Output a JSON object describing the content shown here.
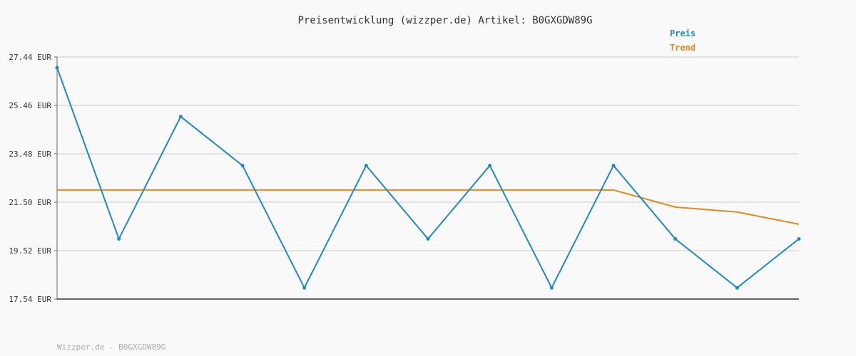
{
  "colors": {
    "price": "#1f88c8",
    "trend": "#e0891f",
    "grid": "#e2e2e2",
    "axis": "#666666",
    "background": "#f9f9f9"
  },
  "chart_data": {
    "type": "line",
    "title": "Preisentwicklung (wizzper.de) Artikel: B0GXGDW89G",
    "xlabel": "",
    "ylabel": "",
    "x": [
      0,
      1,
      2,
      3,
      4,
      5,
      6,
      7,
      8,
      9,
      10,
      11,
      12
    ],
    "ylim": [
      17.54,
      27.44
    ],
    "yticks": [
      17.54,
      19.52,
      21.5,
      23.48,
      25.46,
      27.44
    ],
    "ytick_labels": [
      "17.54 EUR",
      "19.52 EUR",
      "21.50 EUR",
      "23.48 EUR",
      "25.46 EUR",
      "27.44 EUR"
    ],
    "grid": true,
    "legend_position": "top-right",
    "series": [
      {
        "name": "Preis",
        "values": [
          27.0,
          20.0,
          25.0,
          23.0,
          18.0,
          23.0,
          20.0,
          23.0,
          18.0,
          23.0,
          20.0,
          18.0,
          20.0
        ],
        "markers": true
      },
      {
        "name": "Trend",
        "values": [
          22.0,
          22.0,
          22.0,
          22.0,
          22.0,
          22.0,
          22.0,
          22.0,
          22.0,
          22.0,
          21.3,
          21.1,
          20.6
        ],
        "markers": false
      }
    ]
  },
  "footer": {
    "text": "Wizzper.de - B0GXGDW89G"
  }
}
